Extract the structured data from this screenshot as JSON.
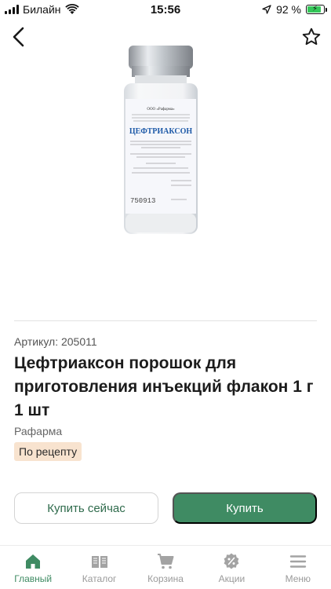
{
  "status_bar": {
    "carrier": "Билайн",
    "time": "15:56",
    "battery_percent": "92 %",
    "battery_level": 0.92
  },
  "product": {
    "sku": "Артикул: 205011",
    "title": "Цефтриаксон порошок для приготовления инъекций флакон 1 г 1 шт",
    "manufacturer": "Рафарма",
    "prescription_badge": "По рецепту"
  },
  "vial_label": {
    "company": "ООО «Рафарма»",
    "name": "ЦЕФТРИАКСОН",
    "batch": "750913"
  },
  "actions": {
    "buy_now": "Купить сейчас",
    "buy": "Купить"
  },
  "colors": {
    "accent": "#3f8b63",
    "badge_bg": "#f8e3cf"
  },
  "tabbar": {
    "items": [
      {
        "label": "Главный",
        "icon": "home-icon",
        "active": true
      },
      {
        "label": "Каталог",
        "icon": "catalog-icon",
        "active": false
      },
      {
        "label": "Корзина",
        "icon": "cart-icon",
        "active": false
      },
      {
        "label": "Акции",
        "icon": "discount-icon",
        "active": false
      },
      {
        "label": "Меню",
        "icon": "menu-icon",
        "active": false
      }
    ]
  }
}
